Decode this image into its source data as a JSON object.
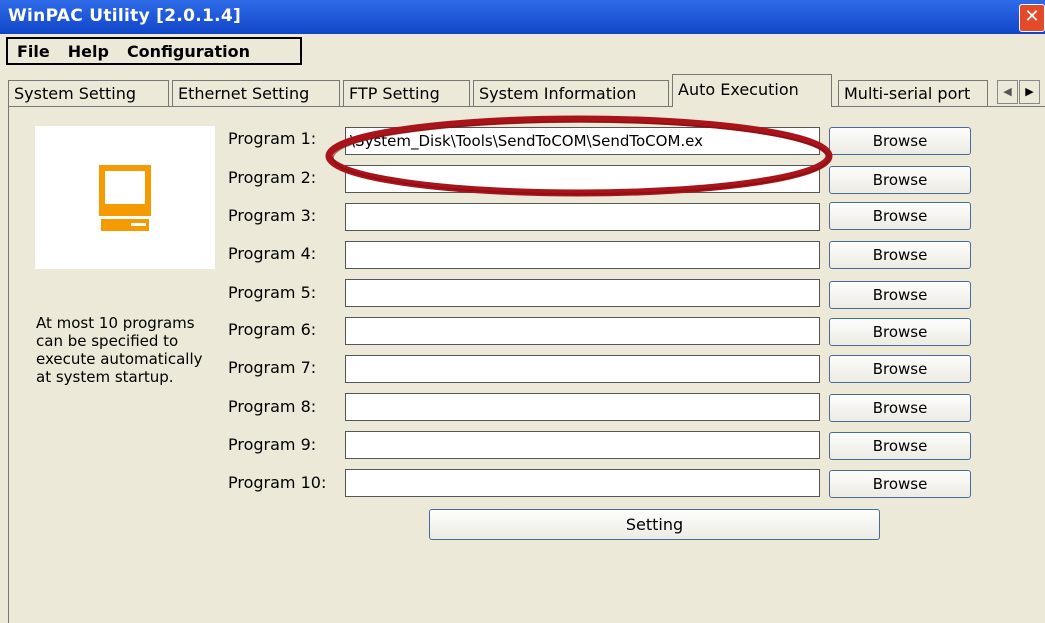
{
  "window": {
    "title": "WinPAC Utility [2.0.1.4]",
    "close_glyph": "✕"
  },
  "menu": {
    "items": [
      "File",
      "Help",
      "Configuration"
    ]
  },
  "tabs": {
    "labels": [
      "System Setting",
      "Ethernet Setting",
      "FTP Setting",
      "System Information",
      "Auto Execution",
      "Multi-serial port"
    ],
    "active": "Auto Execution",
    "scroll_left": "◀",
    "scroll_right": "▶"
  },
  "auto_execution": {
    "description": "At most 10 programs can be specified to execute automatically at system startup.",
    "programs": [
      {
        "label": "Program 1:",
        "value": "\\System_Disk\\Tools\\SendToCOM\\SendToCOM.ex",
        "button": "Browse"
      },
      {
        "label": "Program 2:",
        "value": "",
        "button": "Browse"
      },
      {
        "label": "Program 3:",
        "value": "",
        "button": "Browse"
      },
      {
        "label": "Program 4:",
        "value": "",
        "button": "Browse"
      },
      {
        "label": "Program 5:",
        "value": "",
        "button": "Browse"
      },
      {
        "label": "Program 6:",
        "value": "",
        "button": "Browse"
      },
      {
        "label": "Program 7:",
        "value": "",
        "button": "Browse"
      },
      {
        "label": "Program 8:",
        "value": "",
        "button": "Browse"
      },
      {
        "label": "Program 9:",
        "value": "",
        "button": "Browse"
      },
      {
        "label": "Program 10:",
        "value": "",
        "button": "Browse"
      }
    ],
    "setting_button": "Setting",
    "icon": "computer-icon"
  },
  "colors": {
    "title_bar": "#1f58d6",
    "icon_orange": "#f59a00",
    "annotation_red": "#a8141a",
    "background": "#ece9d8"
  }
}
